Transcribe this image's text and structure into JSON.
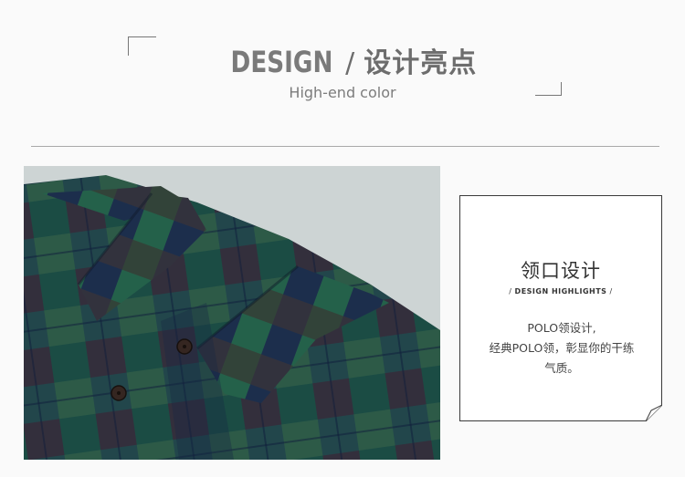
{
  "header": {
    "title_en": "DESIGN",
    "title_sep": "/",
    "title_cn": "设计亮点",
    "subtitle": "High-end color"
  },
  "photo": {
    "subject": "plaid-shirt-collar",
    "colors": {
      "green": "#1f5b48",
      "navy": "#1e2a55",
      "brown": "#4a3a36",
      "background": "#dfe6e6"
    }
  },
  "card": {
    "title": "领口设计",
    "highlight": "DESIGN HIGHLIGHTS",
    "highlight_sep": "/",
    "body_lines": [
      "POLO领设计,",
      "经典POLO领，彰显你的干练",
      "气质。"
    ]
  }
}
